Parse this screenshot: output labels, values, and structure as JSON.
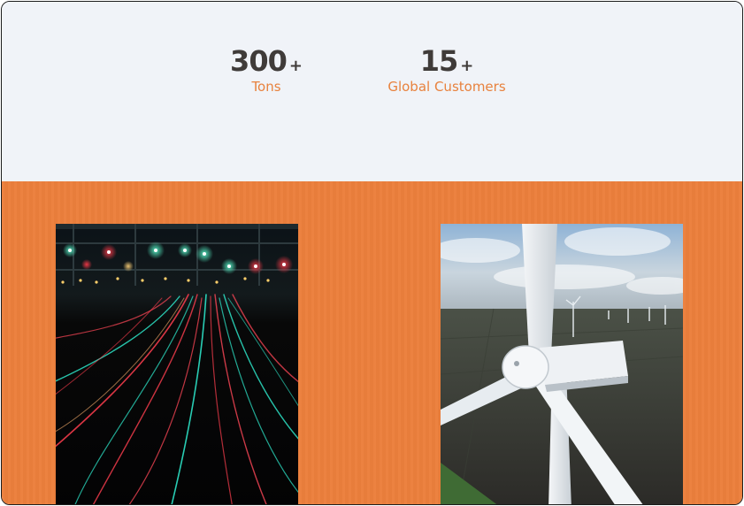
{
  "stats": [
    {
      "number": "300",
      "suffix": "+",
      "label": "Tons"
    },
    {
      "number": "15",
      "suffix": "+",
      "label": "Global Customers"
    }
  ],
  "gallery": {
    "images": [
      {
        "subject": "railway-tracks-at-night"
      },
      {
        "subject": "wind-turbine-aerial"
      }
    ]
  },
  "colors": {
    "accent": "#ec7f3c",
    "label_orange": "#e8823e",
    "number_dark": "#3f3b39",
    "stats_bg": "#f0f3f8"
  }
}
